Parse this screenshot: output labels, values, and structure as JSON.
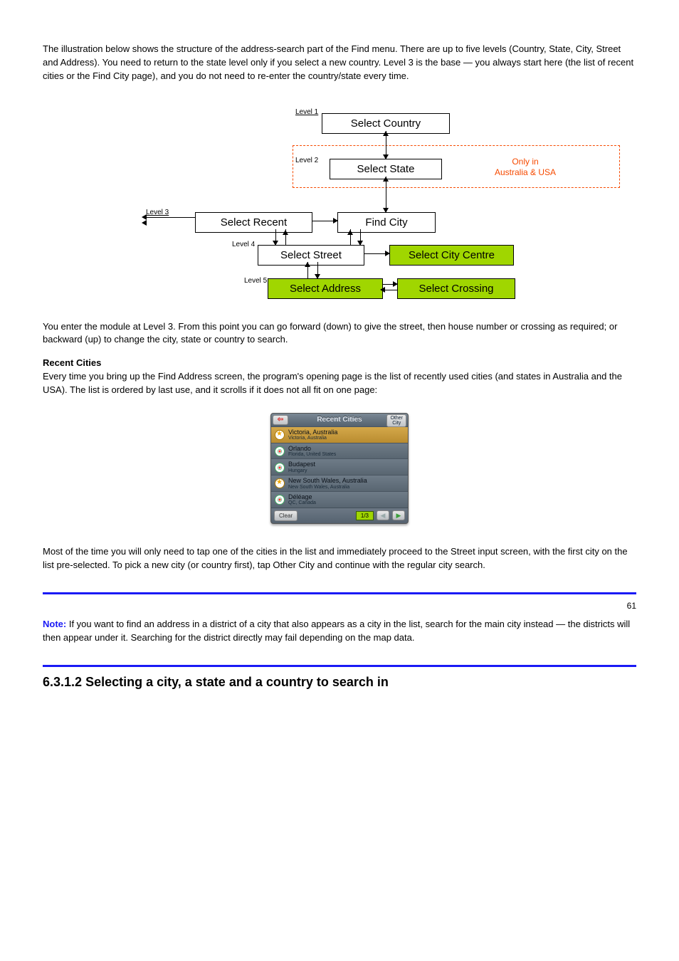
{
  "intro": "The illustration below shows the structure of the address-search part of the Find menu. There are up to five levels (Country, State, City, Street and Address). You need to return to the state level only if you select a new country. Level 3 is the base — you always start here (the list of recent cities or the Find City page), and you do not need to re-enter the country/state every time.",
  "diagram": {
    "level_labels": [
      "Level 1",
      "Level 2",
      "Level 3",
      "Level 4",
      "Level 5"
    ],
    "boxes": {
      "select_country": "Select Country",
      "select_state": "Select State",
      "select_recent": "Select Recent",
      "find_city": "Find City",
      "select_street": "Select Street",
      "select_city_centre": "Select City Centre",
      "select_address": "Select Address",
      "select_crossing": "Select Crossing"
    },
    "note": "Only in\nAustralia & USA"
  },
  "para1": "You enter the module at Level 3. From this point you can go forward (down) to give the street, then house number or crossing as required; or backward (up) to change the city, state or country to search.",
  "heading_recent": "Recent Cities",
  "para2": "Every time you bring up the Find Address screen, the program's opening page is the list of recently used cities (and states in Australia and the USA). The list is ordered by last use, and it scrolls if it does not all fit on one page:",
  "device": {
    "title": "Recent Cities",
    "other_button": "Other\nCity",
    "items": [
      {
        "name": "Victoria, Australia",
        "sub": "Victoria, Australia",
        "icon": "star"
      },
      {
        "name": "Orlando",
        "sub": "Florida, United States",
        "icon": "target"
      },
      {
        "name": "Budapest",
        "sub": "Hungary",
        "icon": "target"
      },
      {
        "name": "New South Wales, Australia",
        "sub": "New South Wales, Australia",
        "icon": "star"
      },
      {
        "name": "Déléage",
        "sub": "QC, Canada",
        "icon": "target"
      }
    ],
    "clear_label": "Clear",
    "page_label": "1/3"
  },
  "para3": "Most of the time you will only need to tap one of the cities in the list and immediately proceed to the Street input screen, with the first city on the list pre-selected. To pick a new city (or country first), tap Other City and continue with the regular city search.",
  "page_number": "61",
  "note_title": "Note:",
  "note_body": "If you want to find an address in a district of a city that also appears as a city in the list, search for the main city instead — the districts will then appear under it. Searching for the district directly may fail depending on the map data.",
  "section_number": "6.3.1.2",
  "section_title": "Selecting a city, a state and a country to search in"
}
